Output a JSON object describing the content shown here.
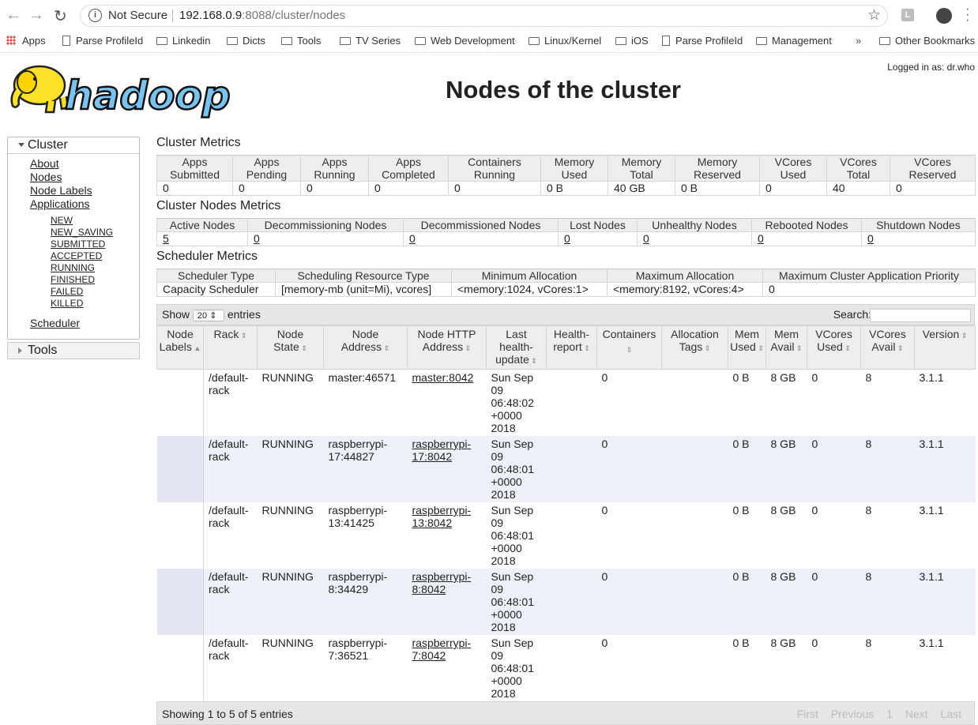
{
  "browser": {
    "security": "Not Secure",
    "url_host": "192.168.0.9",
    "url_rest": ":8088/cluster/nodes",
    "ext_letter": "L"
  },
  "bookmarks": [
    {
      "label": "Apps",
      "kind": "grid"
    },
    {
      "label": "Parse ProfileId",
      "kind": "page"
    },
    {
      "label": "Linkedin",
      "kind": "folder"
    },
    {
      "label": "Dicts",
      "kind": "folder"
    },
    {
      "label": "Tools",
      "kind": "folder"
    },
    {
      "label": "TV Series",
      "kind": "folder"
    },
    {
      "label": "Web Development",
      "kind": "folder"
    },
    {
      "label": "Linux/Kernel",
      "kind": "folder"
    },
    {
      "label": "iOS",
      "kind": "folder"
    },
    {
      "label": "Parse ProfileId",
      "kind": "page"
    },
    {
      "label": "Management",
      "kind": "folder"
    }
  ],
  "bookmarks_more": "»",
  "bookmarks_other": "Other Bookmarks",
  "header": {
    "logo_text": "hadoop",
    "logged_in": "Logged in as: dr.who",
    "title": "Nodes of the cluster"
  },
  "sidebar": {
    "cluster_label": "Cluster",
    "links": [
      "About",
      "Nodes",
      "Node Labels",
      "Applications"
    ],
    "app_states": [
      "NEW",
      "NEW_SAVING",
      "SUBMITTED",
      "ACCEPTED",
      "RUNNING",
      "FINISHED",
      "FAILED",
      "KILLED"
    ],
    "scheduler": "Scheduler",
    "tools_label": "Tools"
  },
  "cluster_metrics": {
    "title": "Cluster Metrics",
    "headers": [
      [
        "Apps",
        "Submitted"
      ],
      [
        "Apps",
        "Pending"
      ],
      [
        "Apps",
        "Running"
      ],
      [
        "Apps",
        "Completed"
      ],
      [
        "Containers",
        "Running"
      ],
      [
        "Memory",
        "Used"
      ],
      [
        "Memory",
        "Total"
      ],
      [
        "Memory",
        "Reserved"
      ],
      [
        "VCores",
        "Used"
      ],
      [
        "VCores",
        "Total"
      ],
      [
        "VCores",
        "Reserved"
      ]
    ],
    "values": [
      "0",
      "0",
      "0",
      "0",
      "0",
      "0 B",
      "40 GB",
      "0 B",
      "0",
      "40",
      "0"
    ]
  },
  "node_metrics": {
    "title": "Cluster Nodes Metrics",
    "headers": [
      "Active Nodes",
      "Decommissioning Nodes",
      "Decommissioned Nodes",
      "Lost Nodes",
      "Unhealthy Nodes",
      "Rebooted Nodes",
      "Shutdown Nodes"
    ],
    "values": [
      "5",
      "0",
      "0",
      "0",
      "0",
      "0",
      "0"
    ]
  },
  "scheduler_metrics": {
    "title": "Scheduler Metrics",
    "headers": [
      "Scheduler Type",
      "Scheduling Resource Type",
      "Minimum Allocation",
      "Maximum Allocation",
      "Maximum Cluster Application Priority"
    ],
    "values": [
      "Capacity Scheduler",
      "[memory-mb (unit=Mi), vcores]",
      "<memory:1024, vCores:1>",
      "<memory:8192, vCores:4>",
      "0"
    ]
  },
  "nodes_table": {
    "show_label": "Show",
    "entries_count": "20",
    "entries_label": "entries",
    "search_label": "Search:",
    "columns": [
      [
        "Node",
        "Labels"
      ],
      [
        "Rack"
      ],
      [
        "Node",
        "State"
      ],
      [
        "Node",
        "Address"
      ],
      [
        "Node HTTP",
        "Address"
      ],
      [
        "Last",
        "health-",
        "update"
      ],
      [
        "Health-",
        "report"
      ],
      [
        "Containers"
      ],
      [
        "Allocation",
        "Tags"
      ],
      [
        "Mem",
        "Used"
      ],
      [
        "Mem",
        "Avail"
      ],
      [
        "VCores",
        "Used"
      ],
      [
        "VCores",
        "Avail"
      ],
      [
        "Version"
      ]
    ],
    "rows": [
      {
        "labels": "",
        "rack": [
          "/default-",
          "rack"
        ],
        "state": "RUNNING",
        "address": [
          "master:46571"
        ],
        "http": [
          "master:8042"
        ],
        "update": [
          "Sun Sep",
          "09",
          "06:48:02",
          "+0000",
          "2018"
        ],
        "health": "",
        "containers": "0",
        "tags": "",
        "mem_used": "0 B",
        "mem_avail": "8 GB",
        "vc_used": "0",
        "vc_avail": "8",
        "version": "3.1.1"
      },
      {
        "labels": "",
        "rack": [
          "/default-",
          "rack"
        ],
        "state": "RUNNING",
        "address": [
          "raspberrypi-",
          "17:44827"
        ],
        "http": [
          "raspberrypi-",
          "17:8042"
        ],
        "update": [
          "Sun Sep",
          "09",
          "06:48:01",
          "+0000",
          "2018"
        ],
        "health": "",
        "containers": "0",
        "tags": "",
        "mem_used": "0 B",
        "mem_avail": "8 GB",
        "vc_used": "0",
        "vc_avail": "8",
        "version": "3.1.1"
      },
      {
        "labels": "",
        "rack": [
          "/default-",
          "rack"
        ],
        "state": "RUNNING",
        "address": [
          "raspberrypi-",
          "13:41425"
        ],
        "http": [
          "raspberrypi-",
          "13:8042"
        ],
        "update": [
          "Sun Sep",
          "09",
          "06:48:01",
          "+0000",
          "2018"
        ],
        "health": "",
        "containers": "0",
        "tags": "",
        "mem_used": "0 B",
        "mem_avail": "8 GB",
        "vc_used": "0",
        "vc_avail": "8",
        "version": "3.1.1"
      },
      {
        "labels": "",
        "rack": [
          "/default-",
          "rack"
        ],
        "state": "RUNNING",
        "address": [
          "raspberrypi-",
          "8:34429"
        ],
        "http": [
          "raspberrypi-",
          "8:8042"
        ],
        "update": [
          "Sun Sep",
          "09",
          "06:48:01",
          "+0000",
          "2018"
        ],
        "health": "",
        "containers": "0",
        "tags": "",
        "mem_used": "0 B",
        "mem_avail": "8 GB",
        "vc_used": "0",
        "vc_avail": "8",
        "version": "3.1.1"
      },
      {
        "labels": "",
        "rack": [
          "/default-",
          "rack"
        ],
        "state": "RUNNING",
        "address": [
          "raspberrypi-",
          "7:36521"
        ],
        "http": [
          "raspberrypi-",
          "7:8042"
        ],
        "update": [
          "Sun Sep",
          "09",
          "06:48:01",
          "+0000",
          "2018"
        ],
        "health": "",
        "containers": "0",
        "tags": "",
        "mem_used": "0 B",
        "mem_avail": "8 GB",
        "vc_used": "0",
        "vc_avail": "8",
        "version": "3.1.1"
      }
    ],
    "info": "Showing 1 to 5 of 5 entries",
    "pager": [
      "First",
      "Previous",
      "1",
      "Next",
      "Last"
    ]
  }
}
